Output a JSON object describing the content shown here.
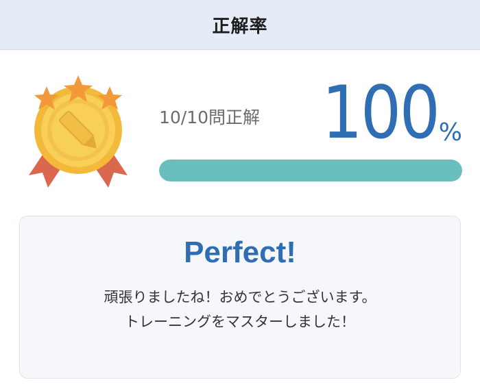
{
  "header": {
    "title": "正解率"
  },
  "result": {
    "score_text": "10/10問正解",
    "percent_value": "100",
    "percent_sign": "%",
    "progress_fraction": 1.0
  },
  "medal": {
    "icon": "gold-medal-icon",
    "stars": 3
  },
  "card": {
    "title": "Perfect!",
    "message_line1": "頑張りましたね！おめでとうございます。",
    "message_line2": "トレーニングをマスターしました！"
  },
  "colors": {
    "header_bg": "#e6ecf7",
    "accent_blue": "#2f6db5",
    "progress_teal": "#6abfbe",
    "medal_gold": "#f5c542",
    "ribbon_red": "#d9684e",
    "star_orange": "#f29a3a"
  }
}
